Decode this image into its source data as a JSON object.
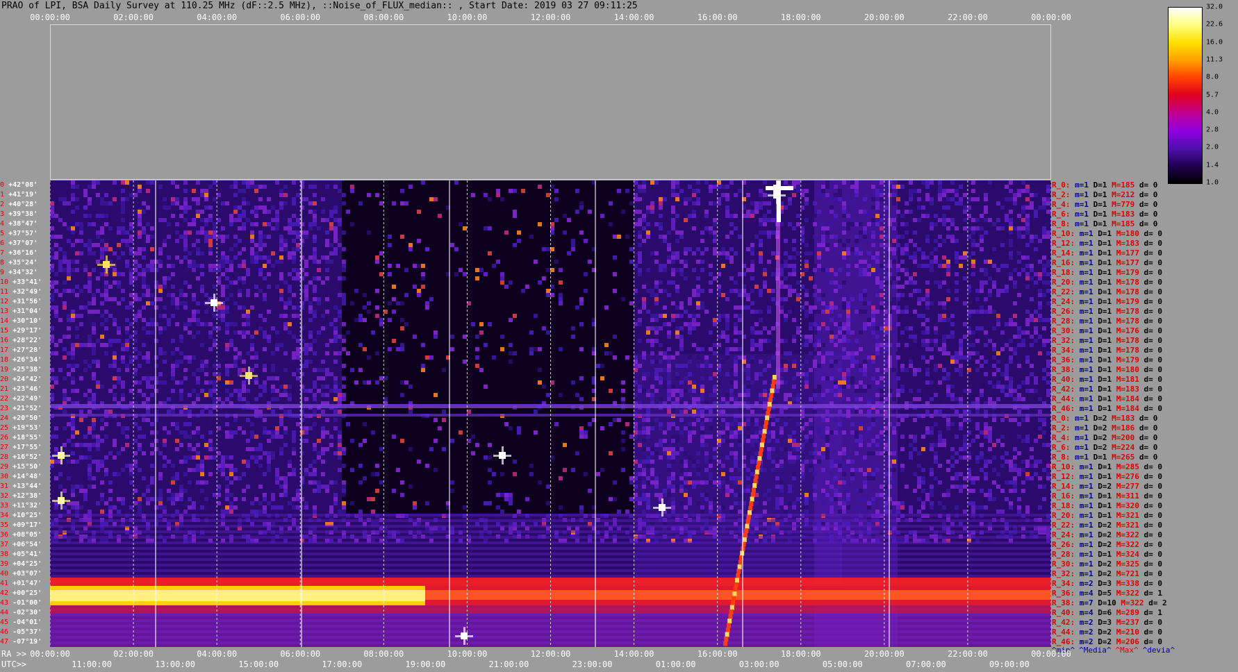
{
  "title": "PRAO of LPI, BSA Daily Survey at 110.25 MHz (dF::2.5 MHz), ::Noise_of_FLUX_median:: , Start Date: 2019 03 27 09:11:25",
  "top_axis_ticks": [
    "00:00:00",
    "02:00:00",
    "04:00:00",
    "06:00:00",
    "08:00:00",
    "10:00:00",
    "12:00:00",
    "14:00:00",
    "16:00:00",
    "18:00:00",
    "20:00:00",
    "22:00:00",
    "00:00:00"
  ],
  "ra_axis": {
    "prefix": "RA >>",
    "ticks": [
      "00:00:00",
      "02:00:00",
      "04:00:00",
      "06:00:00",
      "08:00:00",
      "10:00:00",
      "12:00:00",
      "14:00:00",
      "16:00:00",
      "18:00:00",
      "20:00:00",
      "22:00:00",
      "00:00:00"
    ]
  },
  "utc_axis": {
    "prefix": "UTC>>",
    "ticks": [
      "11:00:00",
      "13:00:00",
      "15:00:00",
      "17:00:00",
      "19:00:00",
      "21:00:00",
      "23:00:00",
      "01:00:00",
      "03:00:00",
      "05:00:00",
      "07:00:00",
      "09:00:00"
    ]
  },
  "colorbar": {
    "labels": [
      "32.0",
      "22.6",
      "16.0",
      "11.3",
      "8.0",
      "5.7",
      "4.0",
      "2.8",
      "2.0",
      "1.4",
      "1.0"
    ],
    "colors": [
      "#ffffff",
      "#ffff80",
      "#ffe000",
      "#ffa000",
      "#ff4000",
      "#e00020",
      "#c00090",
      "#9000e0",
      "#5010b0",
      "#200050",
      "#000000"
    ]
  },
  "declinations": [
    "+42°08'",
    "+41°19'",
    "+40°28'",
    "+39°38'",
    "+38°47'",
    "+37°57'",
    "+37°07'",
    "+36°16'",
    "+35°24'",
    "+34°32'",
    "+33°41'",
    "+32°49'",
    "+31°56'",
    "+31°04'",
    "+30°10'",
    "+29°17'",
    "+28°22'",
    "+27°28'",
    "+26°34'",
    "+25°38'",
    "+24°42'",
    "+23°46'",
    "+22°49'",
    "+21°52'",
    "+20°50'",
    "+19°53'",
    "+18°55'",
    "+17°55'",
    "+16°52'",
    "+15°50'",
    "+14°48'",
    "+13°44'",
    "+12°38'",
    "+11°32'",
    "+10°25'",
    "+09°17'",
    "+08°05'",
    "+06°54'",
    "+05°41'",
    "+04°25'",
    "+03°07'",
    "+01°47'",
    "+00°25'",
    "-01°00'",
    "-02°30'",
    "-04°01'",
    "-05°37'",
    "-07°19'"
  ],
  "dec_indices": [
    "0",
    "1",
    "2",
    "3",
    "4",
    "5",
    "6",
    "7",
    "8",
    "9",
    "10",
    "11",
    "12",
    "13",
    "14",
    "15",
    "16",
    "17",
    "18",
    "19",
    "20",
    "21",
    "22",
    "23",
    "24",
    "25",
    "26",
    "27",
    "28",
    "29",
    "30",
    "31",
    "32",
    "33",
    "34",
    "35",
    "36",
    "37",
    "38",
    "39",
    "40",
    "41",
    "42",
    "43",
    "44",
    "45",
    "46",
    "47"
  ],
  "stats": [
    {
      "r": "R_0:",
      "m": "m=1",
      "d": "D=1",
      "M": "M=185",
      "dv": "d= 0"
    },
    {
      "r": "R_2:",
      "m": "m=1",
      "d": "D=1",
      "M": "M=212",
      "dv": "d= 0"
    },
    {
      "r": "R_4:",
      "m": "m=1",
      "d": "D=1",
      "M": "M=779",
      "dv": "d= 0"
    },
    {
      "r": "R_6:",
      "m": "m=1",
      "d": "D=1",
      "M": "M=183",
      "dv": "d= 0"
    },
    {
      "r": "R_8:",
      "m": "m=1",
      "d": "D=1",
      "M": "M=185",
      "dv": "d= 0"
    },
    {
      "r": "R_10:",
      "m": "m=1",
      "d": "D=1",
      "M": "M=180",
      "dv": "d= 0"
    },
    {
      "r": "R_12:",
      "m": "m=1",
      "d": "D=1",
      "M": "M=183",
      "dv": "d= 0"
    },
    {
      "r": "R_14:",
      "m": "m=1",
      "d": "D=1",
      "M": "M=177",
      "dv": "d= 0"
    },
    {
      "r": "R_16:",
      "m": "m=1",
      "d": "D=1",
      "M": "M=177",
      "dv": "d= 0"
    },
    {
      "r": "R_18:",
      "m": "m=1",
      "d": "D=1",
      "M": "M=179",
      "dv": "d= 0"
    },
    {
      "r": "R_20:",
      "m": "m=1",
      "d": "D=1",
      "M": "M=178",
      "dv": "d= 0"
    },
    {
      "r": "R_22:",
      "m": "m=1",
      "d": "D=1",
      "M": "M=178",
      "dv": "d= 0"
    },
    {
      "r": "R_24:",
      "m": "m=1",
      "d": "D=1",
      "M": "M=179",
      "dv": "d= 0"
    },
    {
      "r": "R_26:",
      "m": "m=1",
      "d": "D=1",
      "M": "M=178",
      "dv": "d= 0"
    },
    {
      "r": "R_28:",
      "m": "m=1",
      "d": "D=1",
      "M": "M=178",
      "dv": "d= 0"
    },
    {
      "r": "R_30:",
      "m": "m=1",
      "d": "D=1",
      "M": "M=176",
      "dv": "d= 0"
    },
    {
      "r": "R_32:",
      "m": "m=1",
      "d": "D=1",
      "M": "M=178",
      "dv": "d= 0"
    },
    {
      "r": "R_34:",
      "m": "m=1",
      "d": "D=1",
      "M": "M=178",
      "dv": "d= 0"
    },
    {
      "r": "R_36:",
      "m": "m=1",
      "d": "D=1",
      "M": "M=179",
      "dv": "d= 0"
    },
    {
      "r": "R_38:",
      "m": "m=1",
      "d": "D=1",
      "M": "M=180",
      "dv": "d= 0"
    },
    {
      "r": "R_40:",
      "m": "m=1",
      "d": "D=1",
      "M": "M=181",
      "dv": "d= 0"
    },
    {
      "r": "R_42:",
      "m": "m=1",
      "d": "D=1",
      "M": "M=183",
      "dv": "d= 0"
    },
    {
      "r": "R_44:",
      "m": "m=1",
      "d": "D=1",
      "M": "M=184",
      "dv": "d= 0"
    },
    {
      "r": "R_46:",
      "m": "m=1",
      "d": "D=1",
      "M": "M=184",
      "dv": "d= 0"
    },
    {
      "r": "R_0:",
      "m": "m=1",
      "d": "D=2",
      "M": "M=183",
      "dv": "d= 0"
    },
    {
      "r": "R_2:",
      "m": "m=1",
      "d": "D=2",
      "M": "M=186",
      "dv": "d= 0"
    },
    {
      "r": "R_4:",
      "m": "m=1",
      "d": "D=2",
      "M": "M=200",
      "dv": "d= 0"
    },
    {
      "r": "R_6:",
      "m": "m=1",
      "d": "D=2",
      "M": "M=224",
      "dv": "d= 0"
    },
    {
      "r": "R_8:",
      "m": "m=1",
      "d": "D=1",
      "M": "M=265",
      "dv": "d= 0"
    },
    {
      "r": "R_10:",
      "m": "m=1",
      "d": "D=1",
      "M": "M=285",
      "dv": "d= 0"
    },
    {
      "r": "R_12:",
      "m": "m=1",
      "d": "D=1",
      "M": "M=276",
      "dv": "d= 0"
    },
    {
      "r": "R_14:",
      "m": "m=1",
      "d": "D=2",
      "M": "M=277",
      "dv": "d= 0"
    },
    {
      "r": "R_16:",
      "m": "m=1",
      "d": "D=1",
      "M": "M=311",
      "dv": "d= 0"
    },
    {
      "r": "R_18:",
      "m": "m=1",
      "d": "D=1",
      "M": "M=320",
      "dv": "d= 0"
    },
    {
      "r": "R_20:",
      "m": "m=1",
      "d": "D=1",
      "M": "M=321",
      "dv": "d= 0"
    },
    {
      "r": "R_22:",
      "m": "m=1",
      "d": "D=2",
      "M": "M=321",
      "dv": "d= 0"
    },
    {
      "r": "R_24:",
      "m": "m=1",
      "d": "D=2",
      "M": "M=322",
      "dv": "d= 0"
    },
    {
      "r": "R_26:",
      "m": "m=1",
      "d": "D=2",
      "M": "M=322",
      "dv": "d= 0"
    },
    {
      "r": "R_28:",
      "m": "m=1",
      "d": "D=1",
      "M": "M=324",
      "dv": "d= 0"
    },
    {
      "r": "R_30:",
      "m": "m=1",
      "d": "D=2",
      "M": "M=325",
      "dv": "d= 0"
    },
    {
      "r": "R_32:",
      "m": "m=1",
      "d": "D=2",
      "M": "M=721",
      "dv": "d= 0"
    },
    {
      "r": "R_34:",
      "m": "m=2",
      "d": "D=3",
      "M": "M=338",
      "dv": "d= 0"
    },
    {
      "r": "R_36:",
      "m": "m=4",
      "d": "D=5",
      "M": "M=322",
      "dv": "d= 1"
    },
    {
      "r": "R_38:",
      "m": "m=7",
      "d": "D=10",
      "M": "M=322",
      "dv": "d= 2"
    },
    {
      "r": "R_40:",
      "m": "m=4",
      "d": "D=6",
      "M": "M=289",
      "dv": "d= 1"
    },
    {
      "r": "R_42:",
      "m": "m=2",
      "d": "D=3",
      "M": "M=237",
      "dv": "d= 0"
    },
    {
      "r": "R_44:",
      "m": "m=2",
      "d": "D=2",
      "M": "M=210",
      "dv": "d= 0"
    },
    {
      "r": "R_46:",
      "m": "m=2",
      "d": "D=2",
      "M": "M=206",
      "dv": "d= 0"
    }
  ],
  "legend": {
    "min": "^min^",
    "median": "^Media^",
    "max": "^Max^",
    "deviation": "^devia^"
  }
}
